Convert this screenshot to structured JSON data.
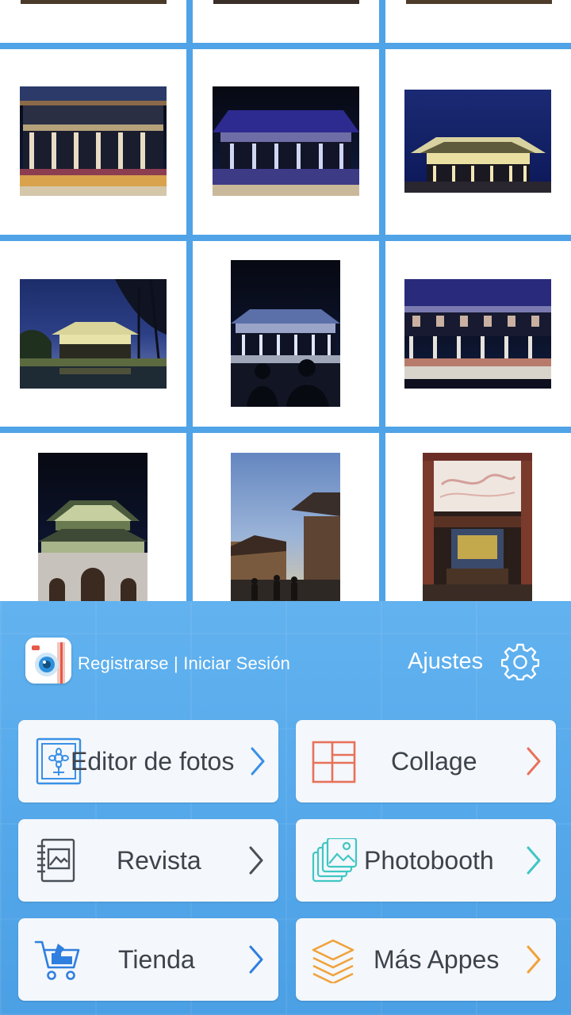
{
  "header": {
    "login_text": "Registrarse | Iniciar Sesión",
    "settings_label": "Ajustes",
    "settings_icon": "gear-icon",
    "app_icon": "camera-app-icon"
  },
  "menu": [
    {
      "label": "Editor de fotos",
      "icon": "photo-editor-icon",
      "chevron_color": "#3a90e6"
    },
    {
      "label": "Collage",
      "icon": "collage-grid-icon",
      "chevron_color": "#e8715a"
    },
    {
      "label": "Revista",
      "icon": "magazine-icon",
      "chevron_color": "#4a5058"
    },
    {
      "label": "Photobooth",
      "icon": "photobooth-stack-icon",
      "chevron_color": "#3fc6c4"
    },
    {
      "label": "Tienda",
      "icon": "shopping-cart-icon",
      "chevron_color": "#2f7fe0"
    },
    {
      "label": "Más Appes",
      "icon": "layers-icon",
      "chevron_color": "#f0a23a"
    }
  ],
  "colors": {
    "grid_background": "#4fa3e6",
    "panel_background": "#56aaea",
    "tile_background": "#f4f7fb",
    "tile_text": "#3d434b"
  }
}
